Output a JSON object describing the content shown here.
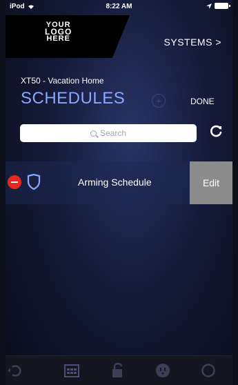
{
  "status": {
    "carrier": "iPod",
    "time": "8:22 AM"
  },
  "header": {
    "logo_line1": "YOUR",
    "logo_line2": "LOGO",
    "logo_line3": "HERE",
    "systems_label": "SYSTEMS >"
  },
  "page": {
    "subtitle": "XT50 - Vacation Home",
    "title": "SCHEDULES",
    "add_symbol": "+",
    "done_label": "DONE"
  },
  "search": {
    "placeholder": "Search",
    "refresh_symbol": "↻"
  },
  "schedules": [
    {
      "label": "Arming Schedule",
      "edit_label": "Edit"
    }
  ],
  "tabs": [
    "back-icon",
    "calendar-icon",
    "lock-icon",
    "outlet-icon",
    "circle-icon"
  ]
}
